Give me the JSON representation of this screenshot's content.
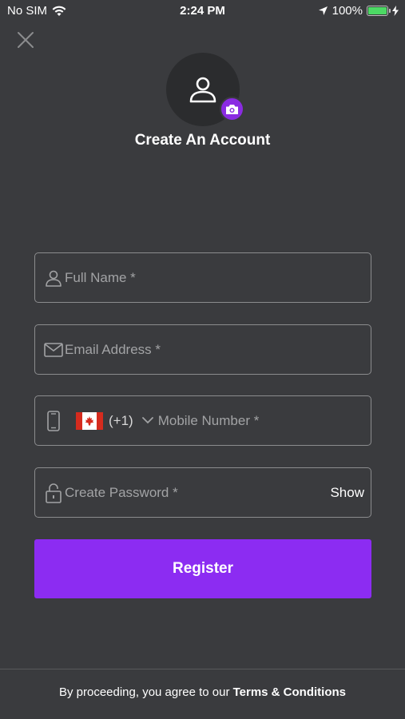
{
  "status_bar": {
    "carrier": "No SIM",
    "time": "2:24 PM",
    "battery": "100%"
  },
  "header": {
    "title": "Create An Account"
  },
  "form": {
    "full_name": {
      "placeholder": "Full Name *",
      "value": ""
    },
    "email": {
      "placeholder": "Email Address *",
      "value": ""
    },
    "mobile": {
      "country_code": "(+1)",
      "country_flag": "Canada",
      "placeholder": "Mobile Number *",
      "value": ""
    },
    "password": {
      "placeholder": "Create Password *",
      "value": "",
      "show_label": "Show"
    }
  },
  "register_button": {
    "label": "Register"
  },
  "footer": {
    "prefix": "By proceeding, you agree to our ",
    "link": "Terms & Conditions"
  },
  "colors": {
    "background": "#3a3b3e",
    "accent": "#8c2cf2",
    "field_border": "#8b8c8e",
    "placeholder": "#a2a3a5"
  },
  "icons": {
    "close": "close-icon",
    "avatar": "user-icon",
    "camera": "camera-icon",
    "name": "person-icon",
    "email": "envelope-icon",
    "phone": "phone-icon",
    "chevron": "chevron-down-icon",
    "password": "lock-icon"
  }
}
